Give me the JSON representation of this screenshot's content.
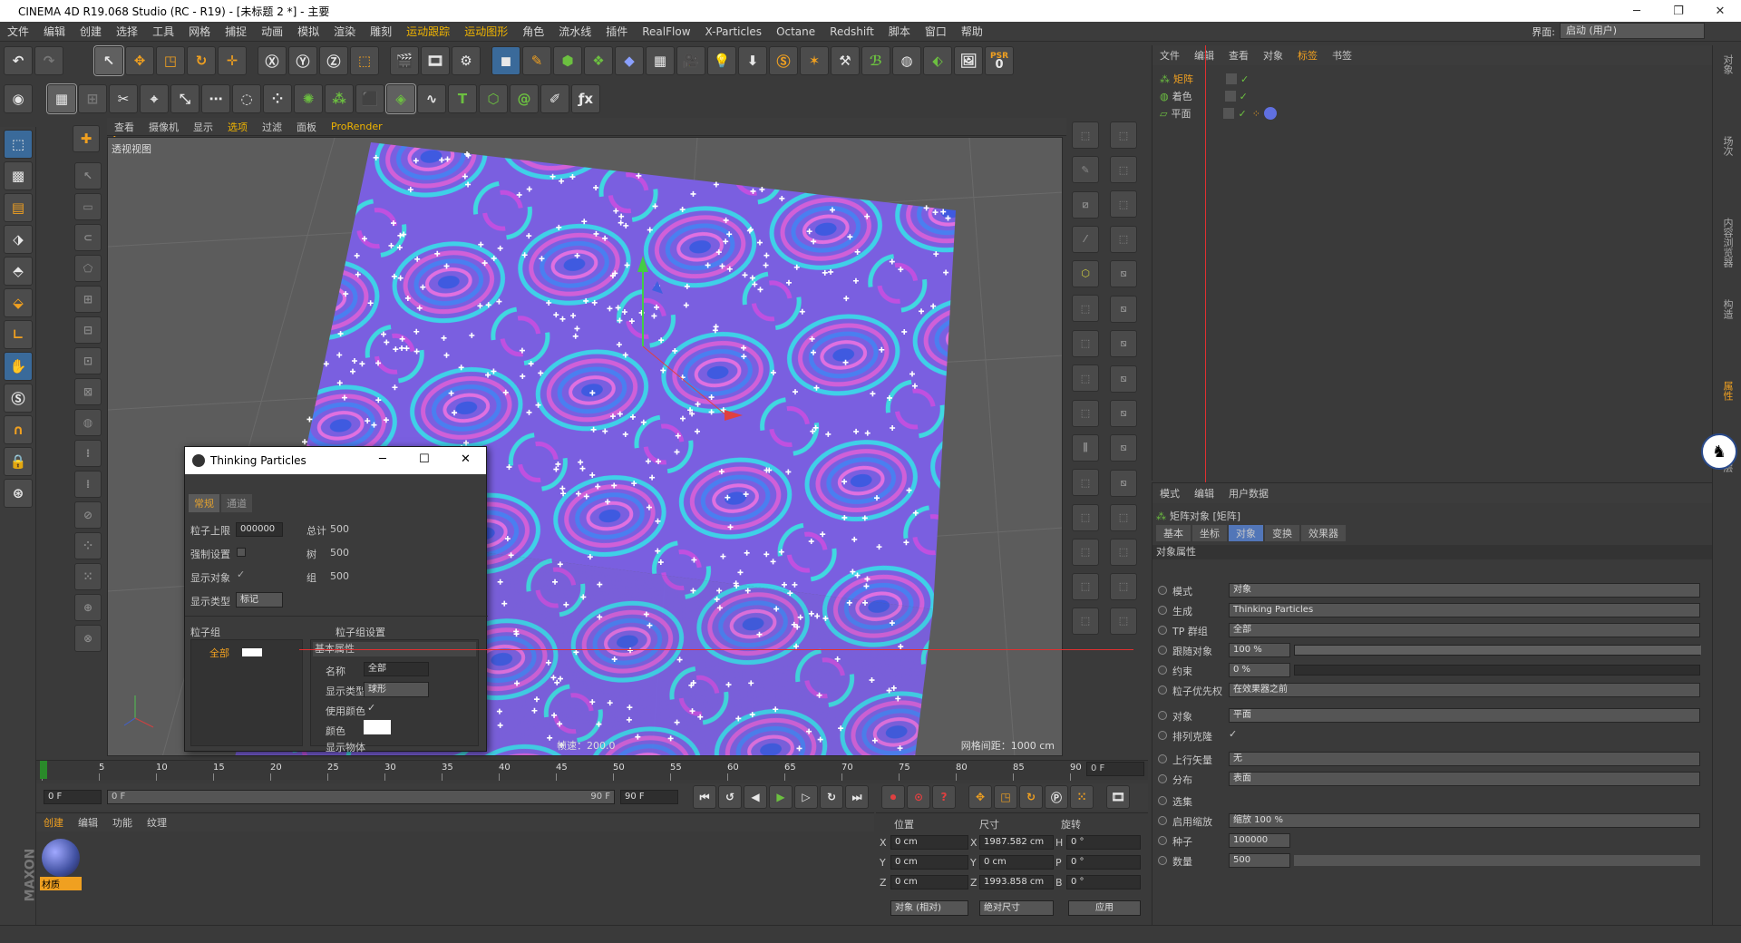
{
  "app": {
    "title": "CINEMA 4D R19.068 Studio (RC - R19) - [未标题 2 *] - 主要",
    "layout_label": "界面:",
    "layout_value": "启动 (用户)"
  },
  "menu": [
    "文件",
    "编辑",
    "创建",
    "选择",
    "工具",
    "网格",
    "捕捉",
    "动画",
    "模拟",
    "渲染",
    "雕刻",
    "运动跟踪",
    "运动图形",
    "角色",
    "流水线",
    "插件",
    "RealFlow",
    "X-Particles",
    "Octane",
    "Redshift",
    "脚本",
    "窗口",
    "帮助"
  ],
  "toolbar": {
    "psr_label": "PSR",
    "psr_value": "0"
  },
  "viewport": {
    "menu": [
      "查看",
      "摄像机",
      "显示",
      "选项",
      "过滤",
      "面板",
      "ProRender"
    ],
    "label": "透视视图",
    "fps": "帧速：200.0",
    "grid": "网格间距：1000 cm"
  },
  "tp_dialog": {
    "title": "Thinking Particles",
    "tabs": [
      "常规",
      "通道"
    ],
    "general": {
      "max_label": "粒子上限",
      "max_value": "000000",
      "total_label": "总计",
      "total_value": "500",
      "force_label": "强制设置",
      "tree_label": "树",
      "tree_value": "500",
      "showobj_label": "显示对象",
      "group_label": "组",
      "group_value": "500",
      "disptype_label": "显示类型",
      "disptype_value": "标记"
    },
    "groups_label": "粒子组",
    "group_settings_label": "粒子组设置",
    "group_item": "全部",
    "basic_props": "基本属性",
    "name_label": "名称",
    "name_value": "全部",
    "display_label": "显示类型",
    "display_value": "球形",
    "usecolor_label": "使用颜色",
    "color_label": "颜色",
    "showobj_label": "显示物体"
  },
  "timeline": {
    "ticks": [
      "0",
      "5",
      "10",
      "15",
      "20",
      "25",
      "30",
      "35",
      "40",
      "45",
      "50",
      "55",
      "60",
      "65",
      "70",
      "75",
      "80",
      "85",
      "90"
    ],
    "current": "0 F",
    "start": "0 F",
    "preview_start": "0 F",
    "preview_end": "90 F",
    "end": "90 F"
  },
  "material": {
    "menu": [
      "创建",
      "编辑",
      "功能",
      "纹理"
    ],
    "name": "材质"
  },
  "coords": {
    "headers": [
      "位置",
      "尺寸",
      "旋转"
    ],
    "x": {
      "pos": "0 cm",
      "size": "1987.582 cm",
      "rot_label": "H",
      "rot": "0 °"
    },
    "y": {
      "pos": "0 cm",
      "size": "0 cm",
      "rot_label": "P",
      "rot": "0 °"
    },
    "z": {
      "pos": "0 cm",
      "size": "1993.858 cm",
      "rot_label": "B",
      "rot": "0 °"
    },
    "mode": "对象 (相对)",
    "size_mode": "绝对尺寸",
    "apply": "应用"
  },
  "objects": {
    "menu": [
      "文件",
      "编辑",
      "查看",
      "对象",
      "标签",
      "书签"
    ],
    "items": [
      "矩阵",
      "着色",
      "平面"
    ]
  },
  "attributes": {
    "menu": [
      "模式",
      "编辑",
      "用户数据"
    ],
    "title": "矩阵对象 [矩阵]",
    "tabs": [
      "基本",
      "坐标",
      "对象",
      "变换",
      "效果器"
    ],
    "section": "对象属性",
    "rows": [
      {
        "label": "模式",
        "value": "对象"
      },
      {
        "label": "生成",
        "value": "Thinking Particles"
      },
      {
        "label": "TP 群组",
        "value": "全部"
      },
      {
        "label": "跟随对象",
        "value": "100 %",
        "pct": 100
      },
      {
        "label": "约束",
        "value": "0 %",
        "pct": 0
      },
      {
        "label": "粒子优先权",
        "value": "在效果器之前"
      },
      {
        "label": "对象",
        "value": "平面"
      },
      {
        "label": "排列克隆",
        "value": ""
      },
      {
        "label": "上行矢量",
        "value": "无"
      },
      {
        "label": "分布",
        "value": "表面"
      },
      {
        "label": "选集",
        "value": ""
      },
      {
        "label": "启用缩放",
        "value": "缩放 100 %"
      },
      {
        "label": "种子",
        "value": "100000"
      },
      {
        "label": "数量",
        "value": "500"
      }
    ],
    "enable_label": "启用"
  },
  "sidebar": [
    "对象",
    "场次",
    "内容浏览器",
    "构造",
    "属性",
    "层"
  ]
}
